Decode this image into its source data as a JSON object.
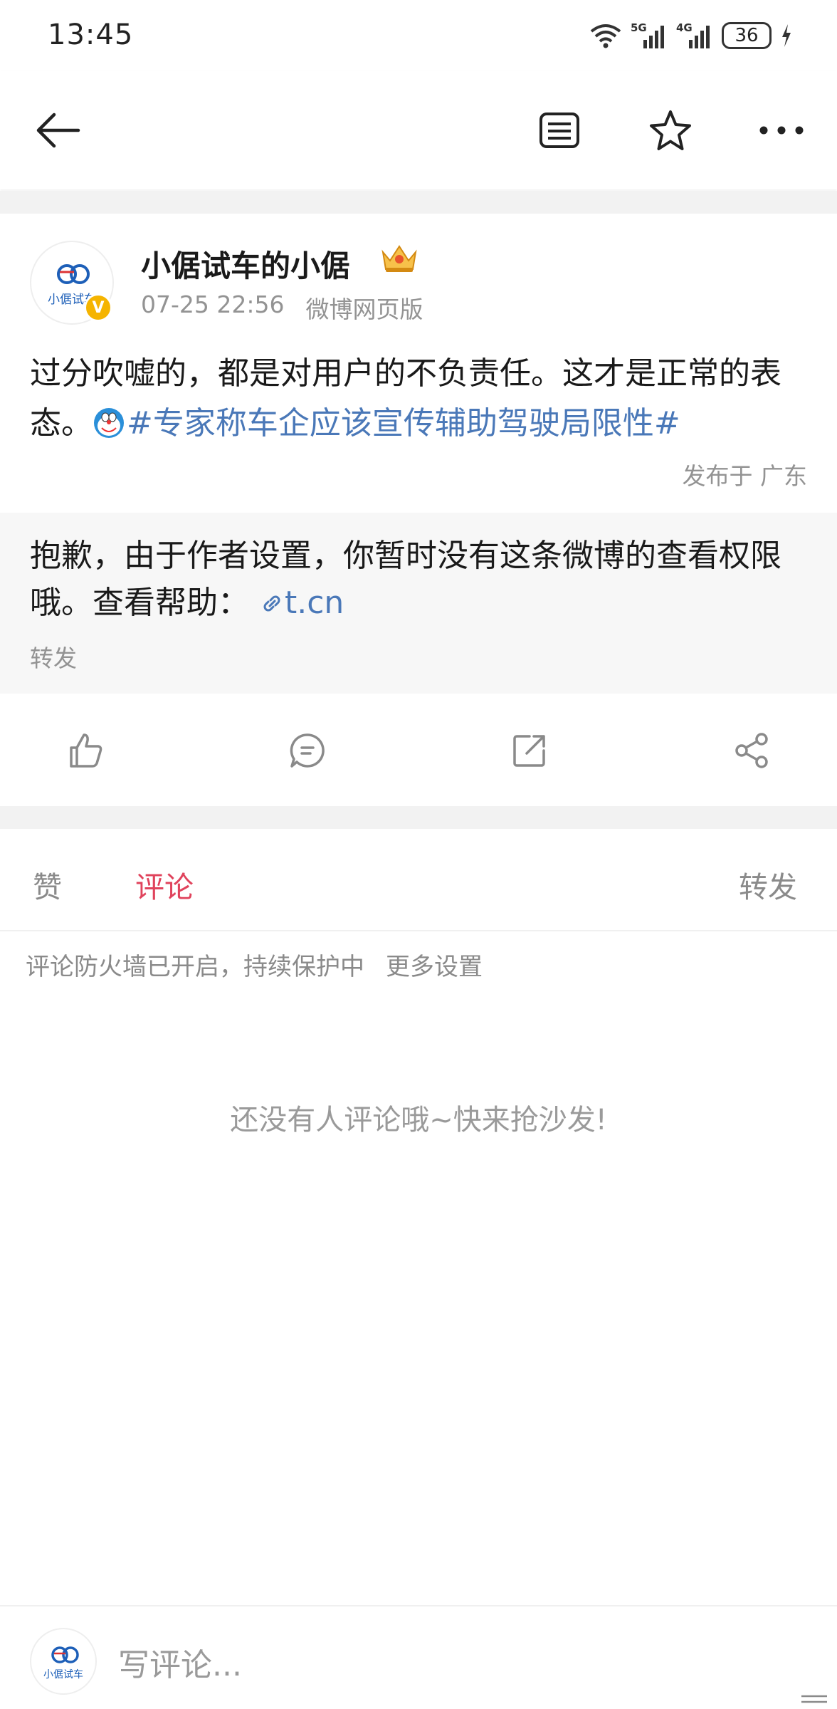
{
  "status": {
    "time": "13:45",
    "battery": "36",
    "net1": "5G",
    "net2": "4G"
  },
  "post": {
    "author": "小倨试车的小倨",
    "avatar_text": "小倨试车",
    "verified_mark": "V",
    "time": "07-25 22:56",
    "source": "微博网页版",
    "text": "过分吹嘘的，都是对用户的不负责任。这才是正常的表态。",
    "hashtag": "#专家称车企应该宣传辅助驾驶局限性#",
    "location": "发布于 广东"
  },
  "repost": {
    "text": "抱歉，由于作者设置，你暂时没有这条微博的查看权限哦。查看帮助：",
    "link": "t.cn",
    "label": "转发"
  },
  "tabs": {
    "likes": "赞",
    "comments": "评论",
    "reposts": "转发"
  },
  "comments": {
    "firewall_note": "评论防火墙已开启，持续保护中",
    "more_settings": "更多设置",
    "empty": "还没有人评论哦~快来抢沙发!"
  },
  "input": {
    "placeholder": "写评论..."
  },
  "colors": {
    "accent": "#e0435c",
    "link": "#4a78b8",
    "muted": "#939393",
    "verified": "#f5b400"
  }
}
